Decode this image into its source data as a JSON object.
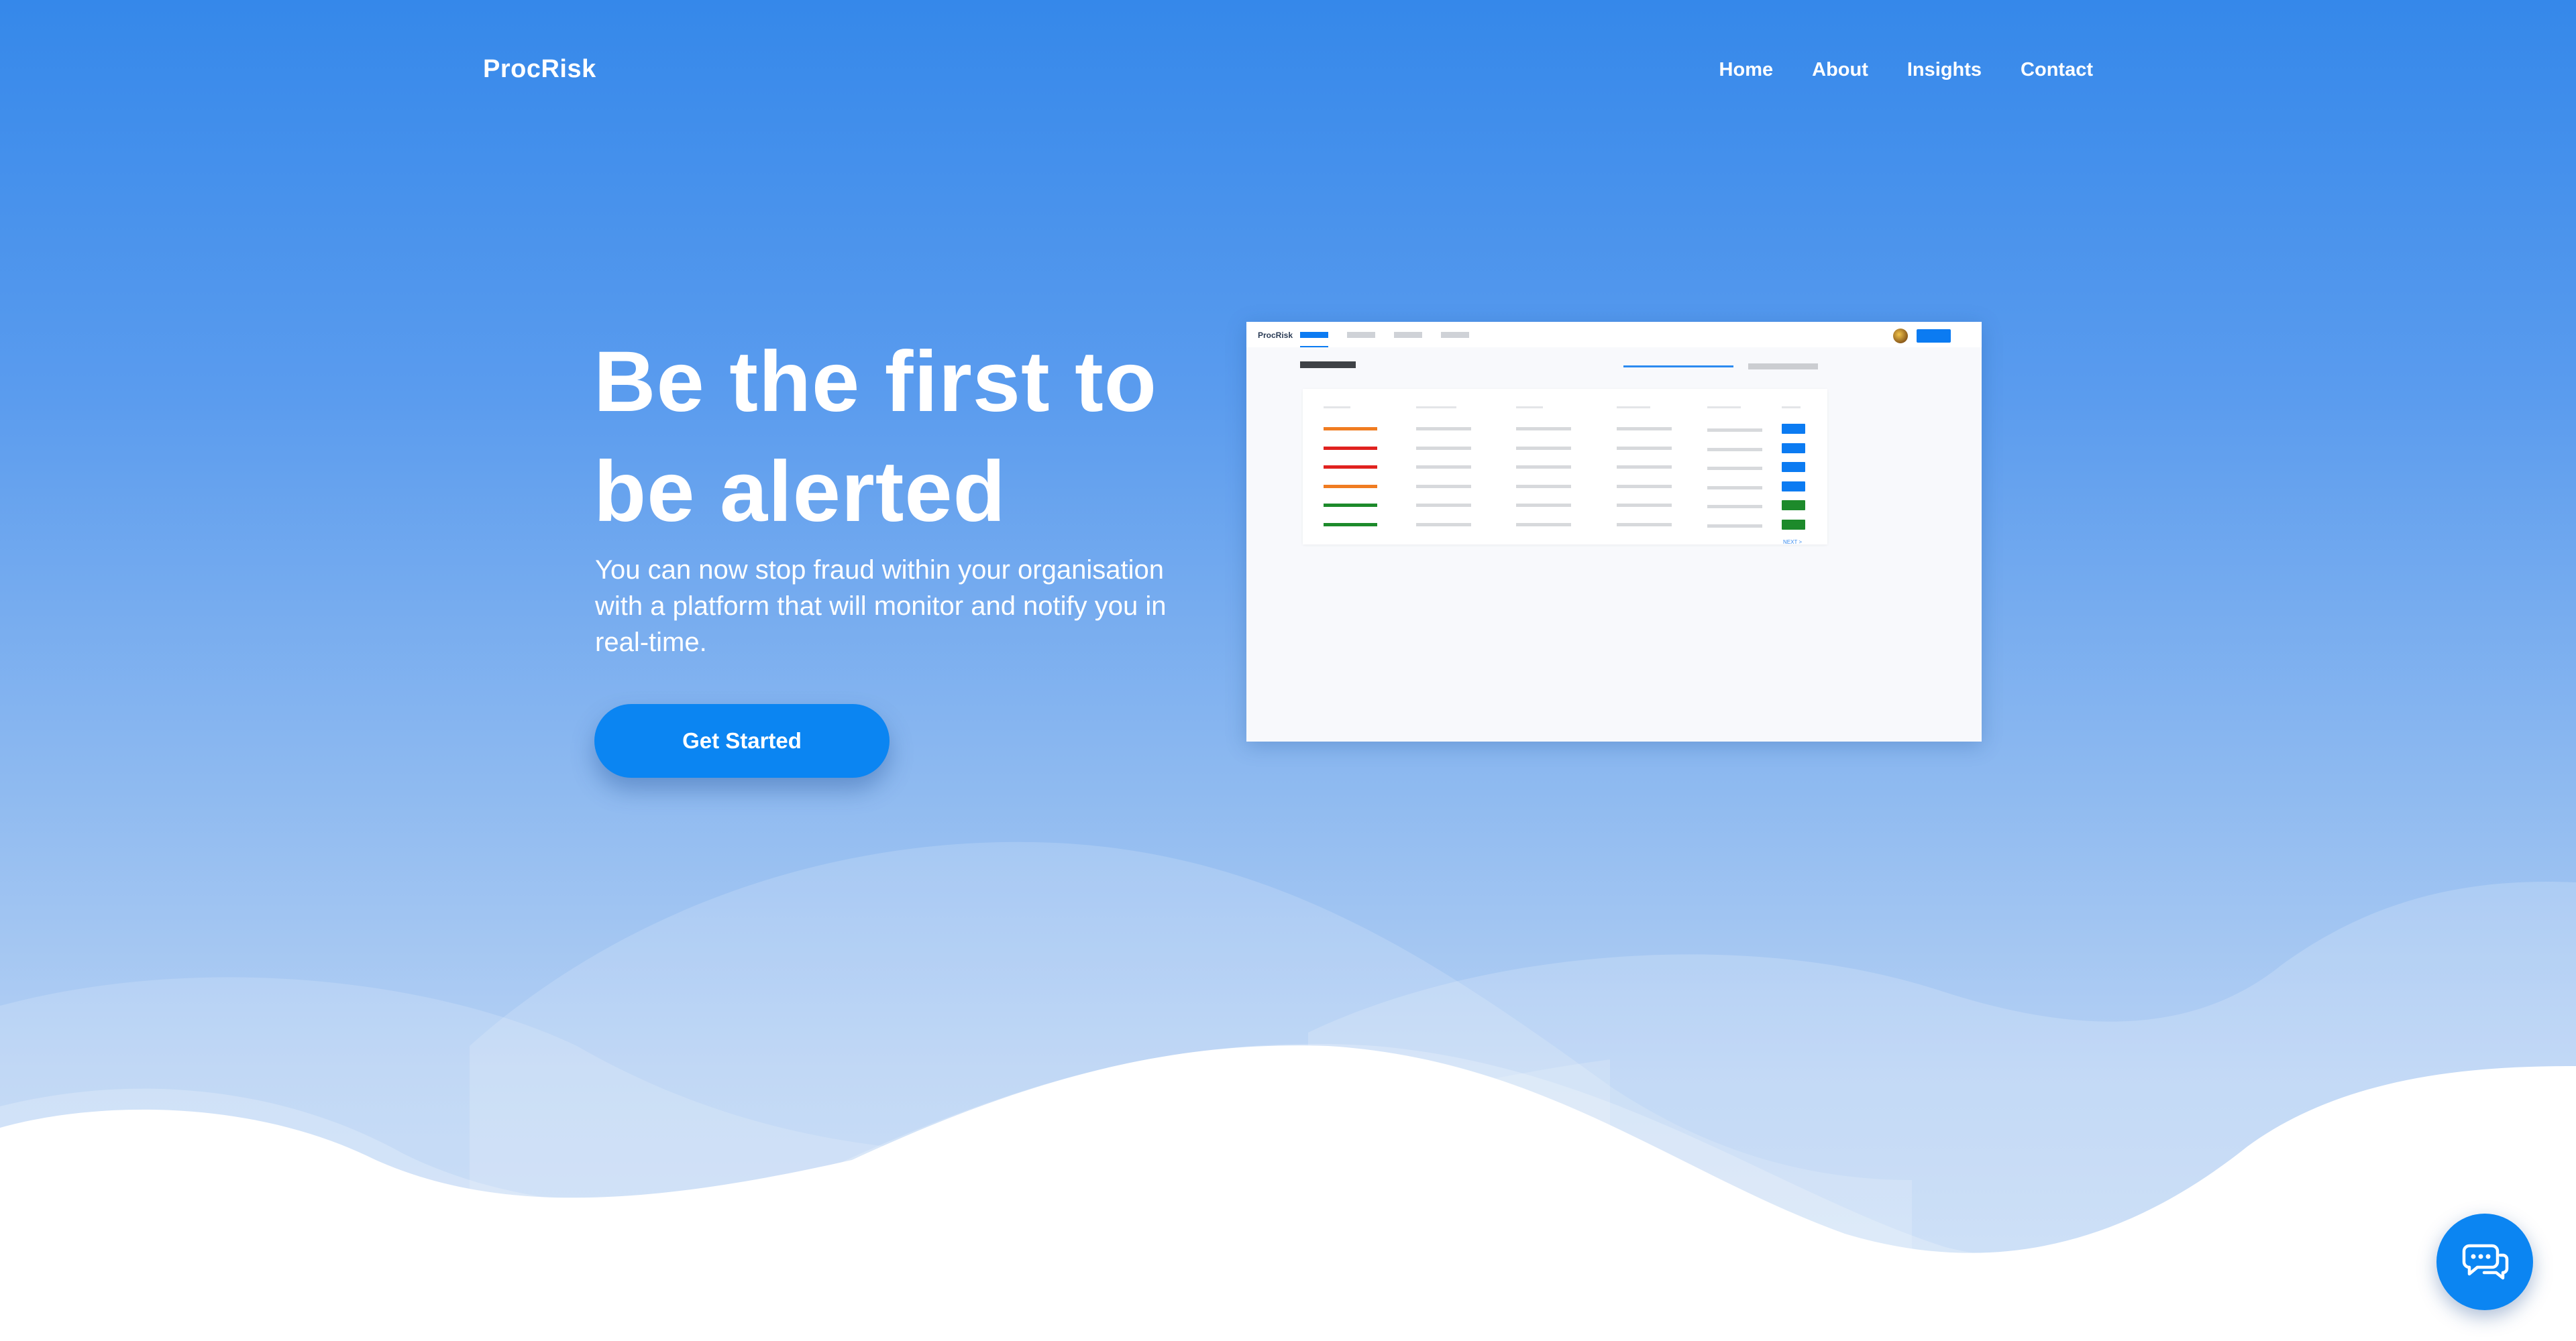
{
  "header": {
    "brand": "ProcRisk",
    "nav": [
      "Home",
      "About",
      "Insights",
      "Contact"
    ]
  },
  "hero": {
    "title_line1": "Be the first to",
    "title_line2": "be alerted",
    "subtitle": "You can now stop fraud within your organisation with a platform that will monitor and notify you in real-time.",
    "cta_label": "Get Started"
  },
  "preview": {
    "brand": "ProcRisk",
    "pagination": "NEXT >",
    "rows": [
      {
        "severity": "orange",
        "action": "blue"
      },
      {
        "severity": "red",
        "action": "blue"
      },
      {
        "severity": "red",
        "action": "blue"
      },
      {
        "severity": "orange",
        "action": "blue"
      },
      {
        "severity": "green",
        "action": "green"
      },
      {
        "severity": "green",
        "action": "green"
      }
    ]
  },
  "chat": {
    "icon": "chat-bubbles-icon"
  },
  "colors": {
    "primary": "#0b85f2",
    "background_top": "#3588ea",
    "severity_orange": "#f07c21",
    "severity_red": "#e0221f",
    "severity_green": "#1d8a2b",
    "action_blue": "#0b7bf2",
    "action_green": "#1d8a2b"
  }
}
